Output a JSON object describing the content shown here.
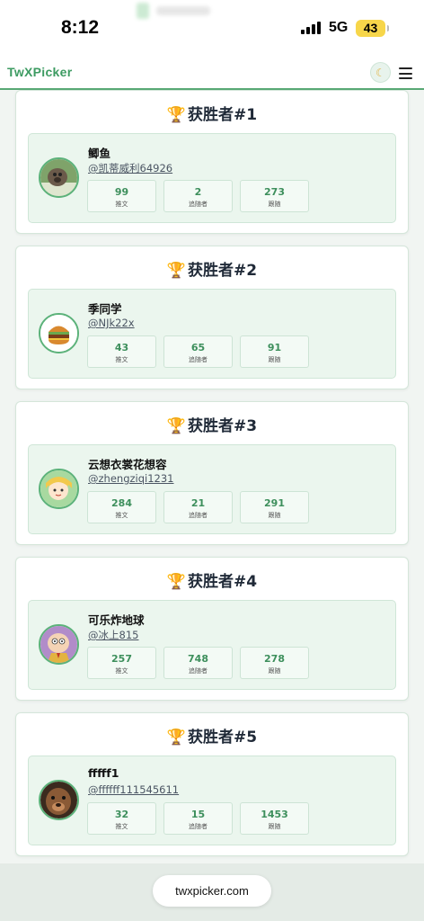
{
  "status_bar": {
    "time": "8:12",
    "network": "5G",
    "battery": "43"
  },
  "navbar": {
    "brand": "TwXPicker",
    "theme_icon": "moon-icon",
    "menu_icon": "hamburger-menu-icon"
  },
  "winners": [
    {
      "title": "获胜者#1",
      "name": "鲫鱼",
      "handle": "@凯蒂威利64926",
      "stats": [
        {
          "value": "99",
          "label": "推文"
        },
        {
          "value": "2",
          "label": "追随者"
        },
        {
          "value": "273",
          "label": "跟随"
        }
      ]
    },
    {
      "title": "获胜者#2",
      "name": "季同学",
      "handle": "@NJk22x",
      "stats": [
        {
          "value": "43",
          "label": "推文"
        },
        {
          "value": "65",
          "label": "追随者"
        },
        {
          "value": "91",
          "label": "跟随"
        }
      ]
    },
    {
      "title": "获胜者#3",
      "name": "云想衣裳花想容",
      "handle": "@zhengziqi1231",
      "stats": [
        {
          "value": "284",
          "label": "推文"
        },
        {
          "value": "21",
          "label": "追随者"
        },
        {
          "value": "291",
          "label": "跟随"
        }
      ]
    },
    {
      "title": "获胜者#4",
      "name": "可乐炸地球",
      "handle": "@冰上815",
      "stats": [
        {
          "value": "257",
          "label": "推文"
        },
        {
          "value": "748",
          "label": "追随者"
        },
        {
          "value": "278",
          "label": "跟随"
        }
      ]
    },
    {
      "title": "获胜者#5",
      "name": "fffff1",
      "handle": "@ffffff111545611",
      "stats": [
        {
          "value": "32",
          "label": "推文"
        },
        {
          "value": "15",
          "label": "追随者"
        },
        {
          "value": "1453",
          "label": "跟随"
        }
      ]
    }
  ],
  "footer": {
    "url": "twxpicker.com"
  },
  "colors": {
    "accent": "#3d9b62",
    "card_inner": "#ebf6ee",
    "trophy": "#d4a017"
  }
}
